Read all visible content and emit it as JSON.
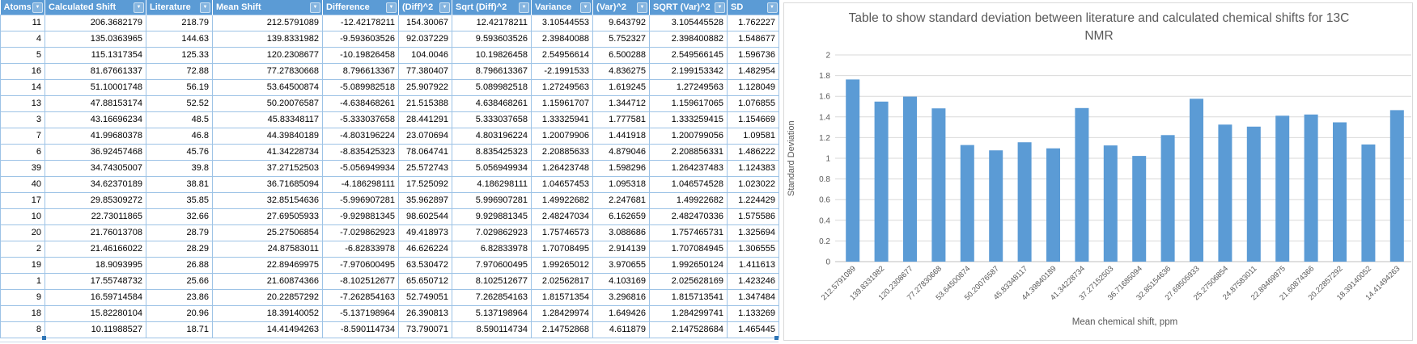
{
  "colors": {
    "header_bg": "#5B9BD5",
    "table_border": "#9DC3E6",
    "bar": "#5B9BD5",
    "gridline": "#D9D9D9",
    "axis_line": "#BFBFBF",
    "chart_text": "#595959",
    "selection_handle": "#2E75B6"
  },
  "table": {
    "columns": [
      "Atoms",
      "Calculated Shift",
      "Literature",
      "Mean Shift",
      "Difference",
      "(Diff)^2",
      "Sqrt (Diff)^2",
      "Variance",
      "(Var)^2",
      "SQRT (Var)^2",
      "SD"
    ],
    "filter_icon": "chevron-down-icon",
    "rows": [
      [
        "11",
        "206.3682179",
        "218.79",
        "212.5791089",
        "-12.42178211",
        "154.30067",
        "12.42178211",
        "3.10544553",
        "9.643792",
        "3.105445528",
        "1.762227"
      ],
      [
        "4",
        "135.0363965",
        "144.63",
        "139.8331982",
        "-9.593603526",
        "92.037229",
        "9.593603526",
        "2.39840088",
        "5.752327",
        "2.398400882",
        "1.548677"
      ],
      [
        "5",
        "115.1317354",
        "125.33",
        "120.2308677",
        "-10.19826458",
        "104.0046",
        "10.19826458",
        "2.54956614",
        "6.500288",
        "2.549566145",
        "1.596736"
      ],
      [
        "16",
        "81.67661337",
        "72.88",
        "77.27830668",
        "8.796613367",
        "77.380407",
        "8.796613367",
        "-2.1991533",
        "4.836275",
        "2.199153342",
        "1.482954"
      ],
      [
        "14",
        "51.10001748",
        "56.19",
        "53.64500874",
        "-5.089982518",
        "25.907922",
        "5.089982518",
        "1.27249563",
        "1.619245",
        "1.27249563",
        "1.128049"
      ],
      [
        "13",
        "47.88153174",
        "52.52",
        "50.20076587",
        "-4.638468261",
        "21.515388",
        "4.638468261",
        "1.15961707",
        "1.344712",
        "1.159617065",
        "1.076855"
      ],
      [
        "3",
        "43.16696234",
        "48.5",
        "45.83348117",
        "-5.333037658",
        "28.441291",
        "5.333037658",
        "1.33325941",
        "1.777581",
        "1.333259415",
        "1.154669"
      ],
      [
        "7",
        "41.99680378",
        "46.8",
        "44.39840189",
        "-4.803196224",
        "23.070694",
        "4.803196224",
        "1.20079906",
        "1.441918",
        "1.200799056",
        "1.09581"
      ],
      [
        "6",
        "36.92457468",
        "45.76",
        "41.34228734",
        "-8.835425323",
        "78.064741",
        "8.835425323",
        "2.20885633",
        "4.879046",
        "2.208856331",
        "1.486222"
      ],
      [
        "39",
        "34.74305007",
        "39.8",
        "37.27152503",
        "-5.056949934",
        "25.572743",
        "5.056949934",
        "1.26423748",
        "1.598296",
        "1.264237483",
        "1.124383"
      ],
      [
        "40",
        "34.62370189",
        "38.81",
        "36.71685094",
        "-4.186298111",
        "17.525092",
        "4.186298111",
        "1.04657453",
        "1.095318",
        "1.046574528",
        "1.023022"
      ],
      [
        "17",
        "29.85309272",
        "35.85",
        "32.85154636",
        "-5.996907281",
        "35.962897",
        "5.996907281",
        "1.49922682",
        "2.247681",
        "1.49922682",
        "1.224429"
      ],
      [
        "10",
        "22.73011865",
        "32.66",
        "27.69505933",
        "-9.929881345",
        "98.602544",
        "9.929881345",
        "2.48247034",
        "6.162659",
        "2.482470336",
        "1.575586"
      ],
      [
        "20",
        "21.76013708",
        "28.79",
        "25.27506854",
        "-7.029862923",
        "49.418973",
        "7.029862923",
        "1.75746573",
        "3.088686",
        "1.757465731",
        "1.325694"
      ],
      [
        "2",
        "21.46166022",
        "28.29",
        "24.87583011",
        "-6.82833978",
        "46.626224",
        "6.82833978",
        "1.70708495",
        "2.914139",
        "1.707084945",
        "1.306555"
      ],
      [
        "19",
        "18.9093995",
        "26.88",
        "22.89469975",
        "-7.970600495",
        "63.530472",
        "7.970600495",
        "1.99265012",
        "3.970655",
        "1.992650124",
        "1.411613"
      ],
      [
        "1",
        "17.55748732",
        "25.66",
        "21.60874366",
        "-8.102512677",
        "65.650712",
        "8.102512677",
        "2.02562817",
        "4.103169",
        "2.025628169",
        "1.423246"
      ],
      [
        "9",
        "16.59714584",
        "23.86",
        "20.22857292",
        "-7.262854163",
        "52.749051",
        "7.262854163",
        "1.81571354",
        "3.296816",
        "1.815713541",
        "1.347484"
      ],
      [
        "18",
        "15.82280104",
        "20.96",
        "18.39140052",
        "-5.137198964",
        "26.390813",
        "5.137198964",
        "1.28429974",
        "1.649426",
        "1.284299741",
        "1.133269"
      ],
      [
        "8",
        "10.11988527",
        "18.71",
        "14.41494263",
        "-8.590114734",
        "73.790071",
        "8.590114734",
        "2.14752868",
        "4.611879",
        "2.147528684",
        "1.465445"
      ]
    ]
  },
  "chart_data": {
    "type": "bar",
    "title": "Table to show standard deviation between literature and calculated chemical shifts for 13C NMR",
    "categories": [
      "212.5791089",
      "139.8331982",
      "120.2308677",
      "77.27830668",
      "53.64500874",
      "50.20076587",
      "45.83348117",
      "44.39840189",
      "41.34228734",
      "37.27152503",
      "36.71685094",
      "32.85154636",
      "27.69505933",
      "25.27506854",
      "24.87583011",
      "22.89469975",
      "21.60874366",
      "20.22857292",
      "18.39140052",
      "14.41494263"
    ],
    "values": [
      1.762227,
      1.548677,
      1.596736,
      1.482954,
      1.128049,
      1.076855,
      1.154669,
      1.09581,
      1.486222,
      1.124383,
      1.023022,
      1.224429,
      1.575586,
      1.325694,
      1.306555,
      1.411613,
      1.423246,
      1.347484,
      1.133269,
      1.465445
    ],
    "xlabel": "Mean chemical shift, ppm",
    "ylabel": "Standard Deviation",
    "ylim": [
      0,
      2
    ],
    "ytick_step": 0.2,
    "yticks": [
      "0",
      "0.2",
      "0.4",
      "0.6",
      "0.8",
      "1",
      "1.2",
      "1.4",
      "1.6",
      "1.8",
      "2"
    ],
    "grid": true,
    "legend": "none",
    "bar_color": "#5B9BD5"
  }
}
